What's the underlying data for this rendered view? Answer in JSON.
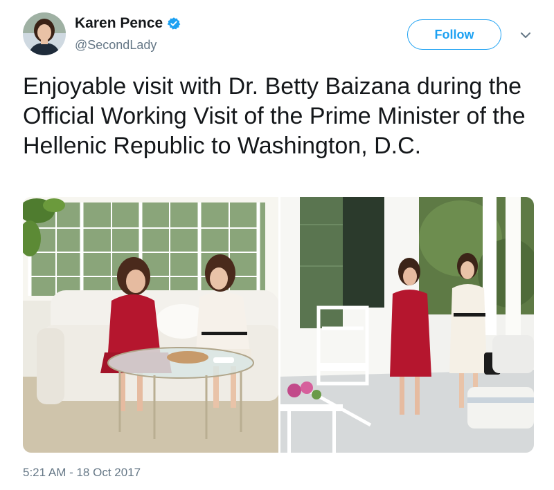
{
  "account": {
    "display_name": "Karen Pence",
    "handle": "@SecondLady",
    "verified": true,
    "avatar_icon": "profile-photo"
  },
  "follow_button": {
    "label": "Follow"
  },
  "menu_icon": "chevron-down-icon",
  "tweet": {
    "text": "Enjoyable visit with Dr. Betty Baizana during the Official Working Visit of the Prime Minister of the Hellenic Republic to Washington, D.C."
  },
  "photos": [
    {
      "scene": "sunroom-seating"
    },
    {
      "scene": "porch-walk"
    }
  ],
  "timestamp": "5:21 AM - 18 Oct 2017",
  "colors": {
    "accent": "#1da1f2",
    "text_primary": "#14171a",
    "text_secondary": "#657786",
    "dress_red": "#b5162e"
  }
}
